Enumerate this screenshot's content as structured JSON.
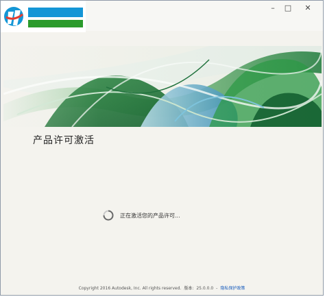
{
  "window": {
    "controls": {
      "minimize": "–",
      "maximize": "□",
      "close": "✕"
    }
  },
  "content": {
    "heading": "产品许可激活",
    "status_text": "正在激活您的产品许可..."
  },
  "footer": {
    "copyright": "Copyright 2016 Autodesk, Inc. All rights reserved.",
    "version_label": "版本:",
    "version": "25.0.0.0",
    "separator": "-",
    "privacy_link": "隐私保护政策"
  },
  "colors": {
    "logo_blue": "#1496d6",
    "logo_green": "#2b9b2c",
    "link": "#1a5dbd"
  }
}
